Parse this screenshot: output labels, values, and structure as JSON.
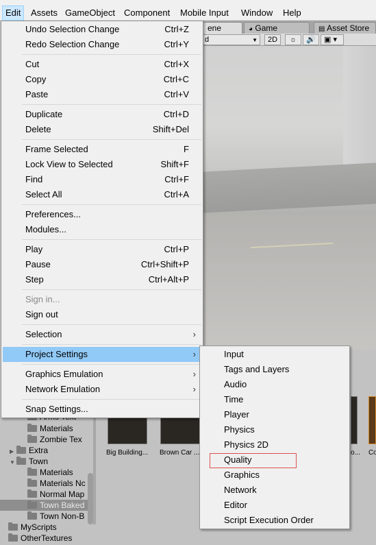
{
  "menubar": {
    "items": [
      "Edit",
      "Assets",
      "GameObject",
      "Component",
      "Mobile Input",
      "Window",
      "Help"
    ]
  },
  "editor": {
    "tabs": [
      "ene",
      "Game",
      "Asset Store"
    ],
    "toolbar": {
      "dropdown": "d",
      "mode_2d": "2D"
    }
  },
  "edit_menu": {
    "items": [
      {
        "label": "Undo Selection Change",
        "shortcut": "Ctrl+Z"
      },
      {
        "label": "Redo Selection Change",
        "shortcut": "Ctrl+Y"
      },
      {
        "label": "Cut",
        "shortcut": "Ctrl+X"
      },
      {
        "label": "Copy",
        "shortcut": "Ctrl+C"
      },
      {
        "label": "Paste",
        "shortcut": "Ctrl+V"
      },
      {
        "label": "Duplicate",
        "shortcut": "Ctrl+D"
      },
      {
        "label": "Delete",
        "shortcut": "Shift+Del"
      },
      {
        "label": "Frame Selected",
        "shortcut": "F"
      },
      {
        "label": "Lock View to Selected",
        "shortcut": "Shift+F"
      },
      {
        "label": "Find",
        "shortcut": "Ctrl+F"
      },
      {
        "label": "Select All",
        "shortcut": "Ctrl+A"
      },
      {
        "label": "Preferences...",
        "shortcut": ""
      },
      {
        "label": "Modules...",
        "shortcut": ""
      },
      {
        "label": "Play",
        "shortcut": "Ctrl+P"
      },
      {
        "label": "Pause",
        "shortcut": "Ctrl+Shift+P"
      },
      {
        "label": "Step",
        "shortcut": "Ctrl+Alt+P"
      },
      {
        "label": "Sign in...",
        "shortcut": ""
      },
      {
        "label": "Sign out",
        "shortcut": ""
      },
      {
        "label": "Selection",
        "shortcut": ""
      },
      {
        "label": "Project Settings",
        "shortcut": ""
      },
      {
        "label": "Graphics Emulation",
        "shortcut": ""
      },
      {
        "label": "Network Emulation",
        "shortcut": ""
      },
      {
        "label": "Snap Settings...",
        "shortcut": ""
      }
    ]
  },
  "project_settings_menu": {
    "items": [
      "Input",
      "Tags and Layers",
      "Audio",
      "Time",
      "Player",
      "Physics",
      "Physics 2D",
      "Quality",
      "Graphics",
      "Network",
      "Editor",
      "Script Execution Order"
    ]
  },
  "project": {
    "tree": [
      "Arms Text",
      "Materials",
      "Zombie Tex",
      "Extra",
      "Town",
      "Materials",
      "Materials Nc",
      "Normal Map",
      "Town Baked",
      "Town Non-B",
      "MyScripts",
      "OtherTextures"
    ],
    "assets": [
      "Big Building...",
      "Brown Car ...",
      "o...",
      "Co"
    ]
  }
}
